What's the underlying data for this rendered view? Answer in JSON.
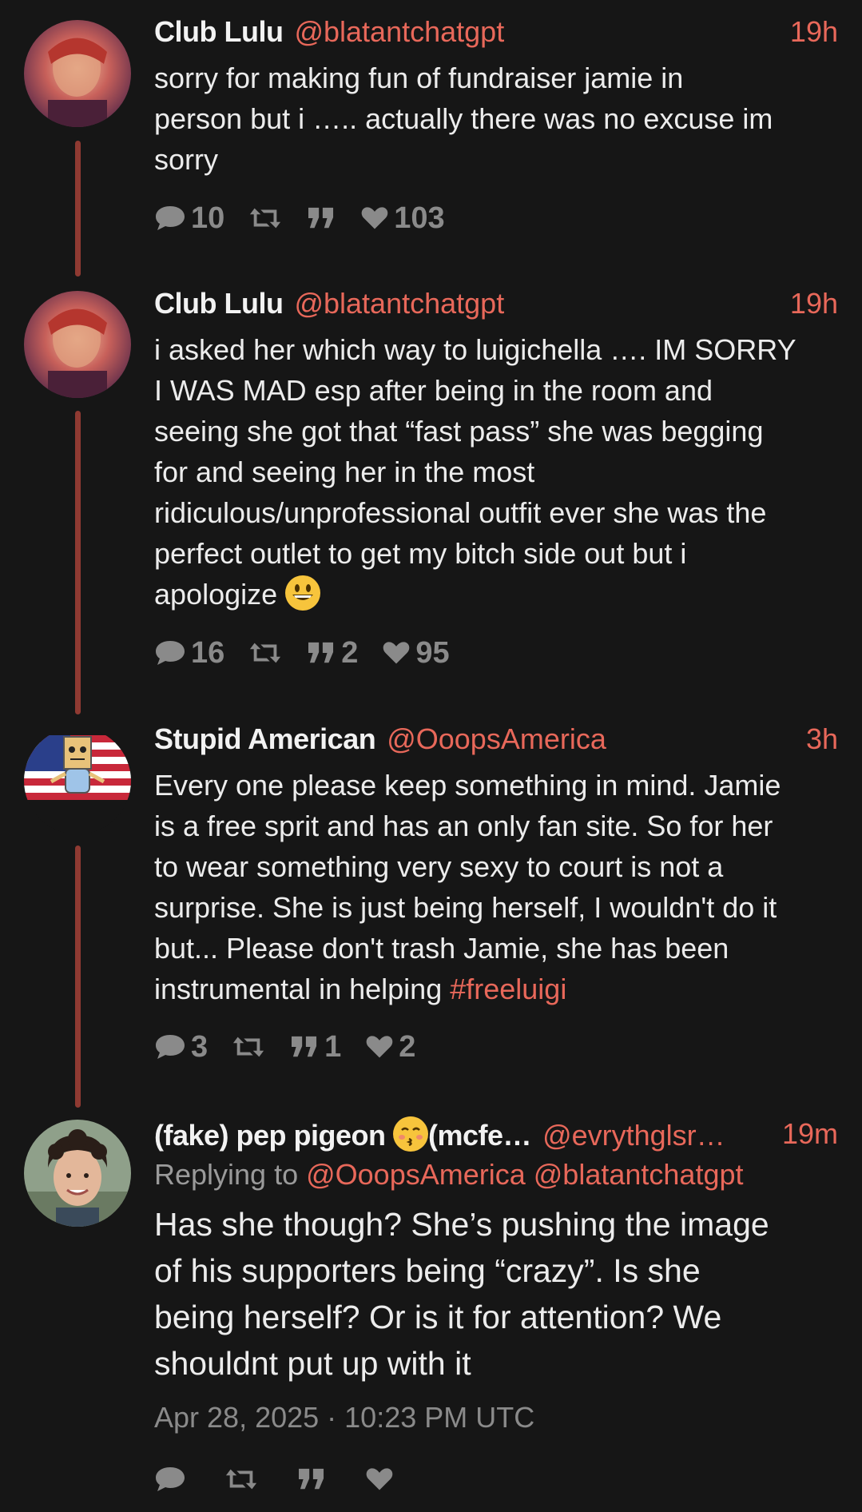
{
  "tweets": [
    {
      "name": "Club Lulu",
      "handle": "@blatantchatgpt",
      "time": "19h",
      "avatar_icon": "person-avatar",
      "body": "sorry for making fun of fundraiser jamie in\nperson but i ….. actually there was no excuse im\nsorry",
      "replies": "10",
      "retweets": "",
      "quotes": "",
      "likes": "103"
    },
    {
      "name": "Club Lulu",
      "handle": "@blatantchatgpt",
      "time": "19h",
      "avatar_icon": "person-avatar",
      "body": "i asked her which way to luigichella …. IM SORRY\nI WAS MAD esp after being in the room and\nseeing she got that “fast pass” she was begging\nfor and seeing her in the most\nridiculous/unprofessional outfit ever she was the\nperfect outlet to get my bitch side out but i\napologize ",
      "emoji": "grinning-face-emoji",
      "replies": "16",
      "retweets": "",
      "quotes": "2",
      "likes": "95"
    },
    {
      "name": "Stupid American",
      "handle": "@OoopsAmerica",
      "time": "3h",
      "avatar_icon": "flag-cartoon-avatar",
      "body": "Every one please keep something in mind. Jamie\nis a free sprit and has an only fan site. So for her\nto wear something very sexy to court is not a\nsurprise. She is just being herself, I wouldn't do it\nbut... Please don't trash Jamie, she has been\ninstrumental in helping ",
      "hashtag": "#freeluigi",
      "replies": "3",
      "retweets": "",
      "quotes": "1",
      "likes": "2"
    },
    {
      "name": "(fake) pep pigeon ",
      "name_emoji": "kissing-face-emoji",
      "name_suffix": "(mcfe…",
      "handle": "@evrythglsr…",
      "time": "19m",
      "avatar_icon": "person-avatar",
      "replying_prefix": "Replying to ",
      "replying_1": "@OoopsAmerica",
      "replying_2": "@blatantchatgpt",
      "body": "Has she though? She’s pushing the image\nof his supporters being “crazy”. Is she\nbeing herself? Or is it for attention? We\nshouldnt put up with it",
      "date": "Apr 28, 2025 · 10:23 PM UTC",
      "replies": "",
      "retweets": "",
      "quotes": "",
      "likes": ""
    }
  ],
  "icons": [
    "comment-icon",
    "retweet-icon",
    "quote-icon",
    "heart-icon"
  ],
  "colors": {
    "accent": "#e8685a",
    "thread_line": "#8f3a32",
    "background": "#161616",
    "muted": "#8a8a8a"
  }
}
